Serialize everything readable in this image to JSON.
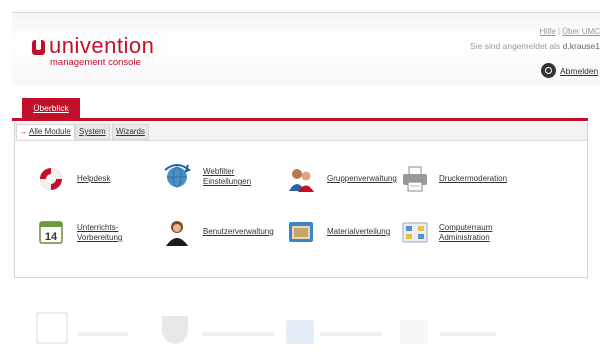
{
  "header": {
    "logo_text": "univention",
    "logo_sub": "management console",
    "help_link": "Hilfe",
    "about_link": "Über UMC",
    "login_prefix": "Sie sind angemeldet als",
    "username": "d.krause1",
    "logout_label": "Abmelden"
  },
  "tabs": {
    "overview_label": "Überblick"
  },
  "subnav": {
    "all_modules": "Alle Module",
    "system": "System",
    "wizards": "Wizards"
  },
  "modules": [
    {
      "label": "Helpdesk",
      "icon": "lifebuoy-icon"
    },
    {
      "label": "Webfilter\nEinstellungen",
      "icon": "globe-arrows-icon"
    },
    {
      "label": "Gruppenverwaltung",
      "icon": "group-icon"
    },
    {
      "label": "Druckermoderation",
      "icon": "printer-icon"
    },
    {
      "label": "Unterrichts-\nVorbereitung",
      "icon": "calendar-icon"
    },
    {
      "label": "Benutzerverwaltung",
      "icon": "user-icon"
    },
    {
      "label": "Materialverteilung",
      "icon": "folder-icon"
    },
    {
      "label": "Computerraum\nAdministration",
      "icon": "computer-room-icon"
    }
  ],
  "calendar_day": "14",
  "colors": {
    "brand": "#c3102a",
    "panel_border": "#d4d4d4"
  }
}
